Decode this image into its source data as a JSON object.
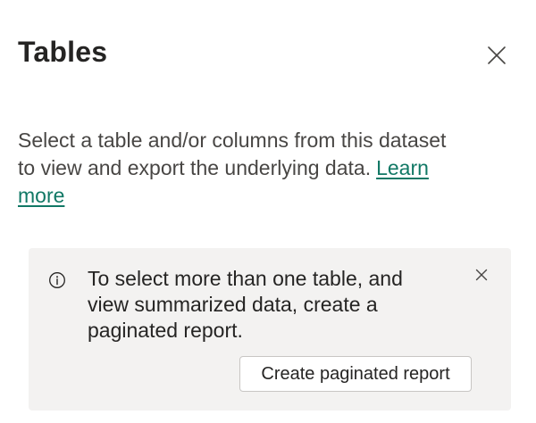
{
  "panel": {
    "title": "Tables",
    "close_icon": "close-icon",
    "description": "Select a table and/or columns from this dataset to view and export the underlying data.",
    "learn_more_label": "Learn more"
  },
  "info_box": {
    "icon": "info-icon",
    "message": "To select more than one table, and view summarized data, create a paginated report.",
    "dismiss_icon": "close-icon",
    "button_label": "Create paginated report"
  },
  "colors": {
    "link": "#117865",
    "info_background": "#f3f2f1",
    "title_text": "#252423",
    "body_text": "#484644"
  }
}
